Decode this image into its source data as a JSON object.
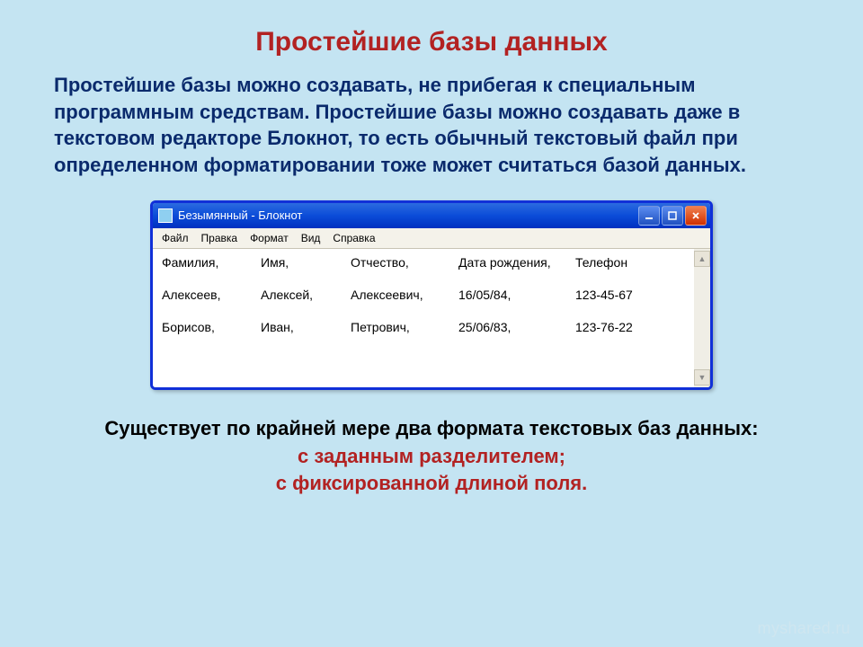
{
  "title": "Простейшие базы данных",
  "paragraph": "Простейшие базы можно создавать, не прибегая к специальным программным средствам. Простейшие базы можно создавать даже в текстовом редакторе Блокнот, то есть обычный текстовый файл при определенном форматировании тоже может считаться базой данных.",
  "window": {
    "title": "Безымянный - Блокнот",
    "menu": [
      "Файл",
      "Правка",
      "Формат",
      "Вид",
      "Справка"
    ],
    "rows": [
      [
        "Фамилия,",
        "Имя,",
        "Отчество,",
        "Дата рождения,",
        "Телефон"
      ],
      [
        "Алексеев,",
        "Алексей,",
        "Алексеевич,",
        "16/05/84,",
        "123-45-67"
      ],
      [
        "Борисов,",
        "Иван,",
        "Петрович,",
        "25/06/83,",
        "123-76-22"
      ]
    ]
  },
  "footer": {
    "line1": "Существует по крайней мере два формата текстовых баз данных:",
    "line2": "с заданным разделителем;",
    "line3": "с фиксированной длиной поля."
  },
  "watermark": "myshared.ru"
}
